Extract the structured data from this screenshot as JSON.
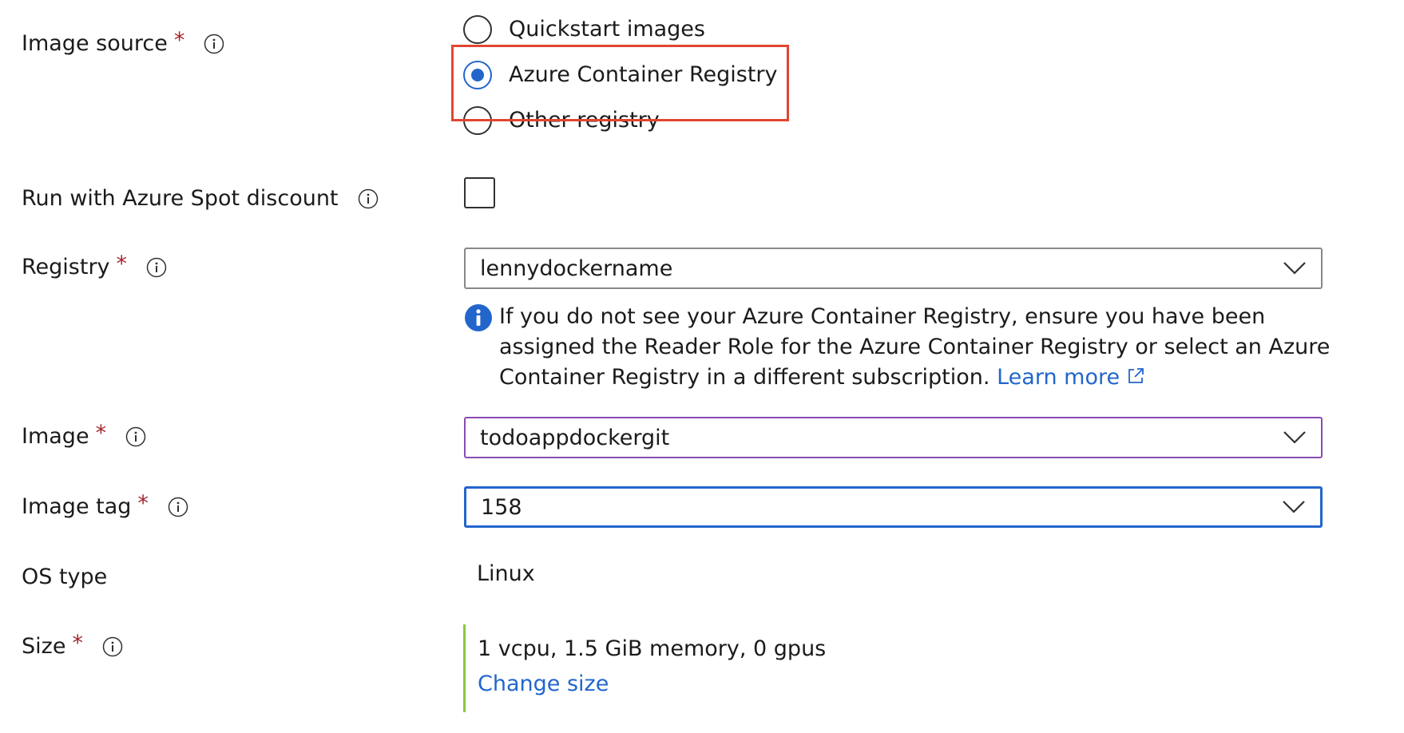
{
  "image_source": {
    "label": "Image source",
    "required_mark": "*",
    "options": [
      {
        "label": "Quickstart images",
        "checked": false
      },
      {
        "label": "Azure Container Registry",
        "checked": true
      },
      {
        "label": "Other registry",
        "checked": false
      }
    ]
  },
  "spot": {
    "label": "Run with Azure Spot discount",
    "checked": false
  },
  "registry": {
    "label": "Registry",
    "required_mark": "*",
    "value": "lennydockername",
    "info_message": "If you do not see your Azure Container Registry, ensure you have been assigned the Reader Role for the Azure Container Registry or select an Azure Container Registry in a different subscription.",
    "learn_more": "Learn more"
  },
  "image": {
    "label": "Image",
    "required_mark": "*",
    "value": "todoappdockergit"
  },
  "image_tag": {
    "label": "Image tag",
    "required_mark": "*",
    "value": "158"
  },
  "os_type": {
    "label": "OS type",
    "value": "Linux"
  },
  "size": {
    "label": "Size",
    "required_mark": "*",
    "value": "1 vcpu, 1.5 GiB memory, 0 gpus",
    "change_link": "Change size"
  },
  "colors": {
    "accent": "#2266cc",
    "required": "#a4262c",
    "highlight": "#e04631",
    "size_bar": "#8cc63f"
  }
}
